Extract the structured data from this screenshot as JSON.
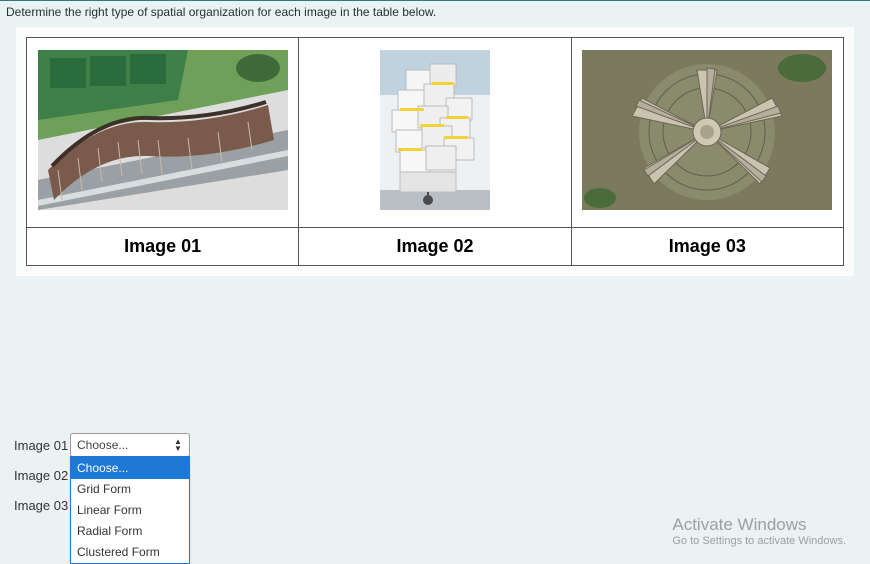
{
  "question": {
    "prompt": "Determine the right type of spatial organization for each image in the table below.",
    "captions": [
      "Image 01",
      "Image 02",
      "Image 03"
    ]
  },
  "answers": {
    "rows": [
      {
        "label": "Image 01",
        "value": "Choose..."
      },
      {
        "label": "Image 02",
        "value": "Choose..."
      },
      {
        "label": "Image 03",
        "value": "Choose..."
      }
    ],
    "dropdown": {
      "open_for_row": 1,
      "options": [
        "Choose...",
        "Grid Form",
        "Linear Form",
        "Radial Form",
        "Clustered Form"
      ],
      "selected": "Choose..."
    }
  },
  "watermark": {
    "line1": "Activate Windows",
    "line2": "Go to Settings to activate Windows."
  }
}
